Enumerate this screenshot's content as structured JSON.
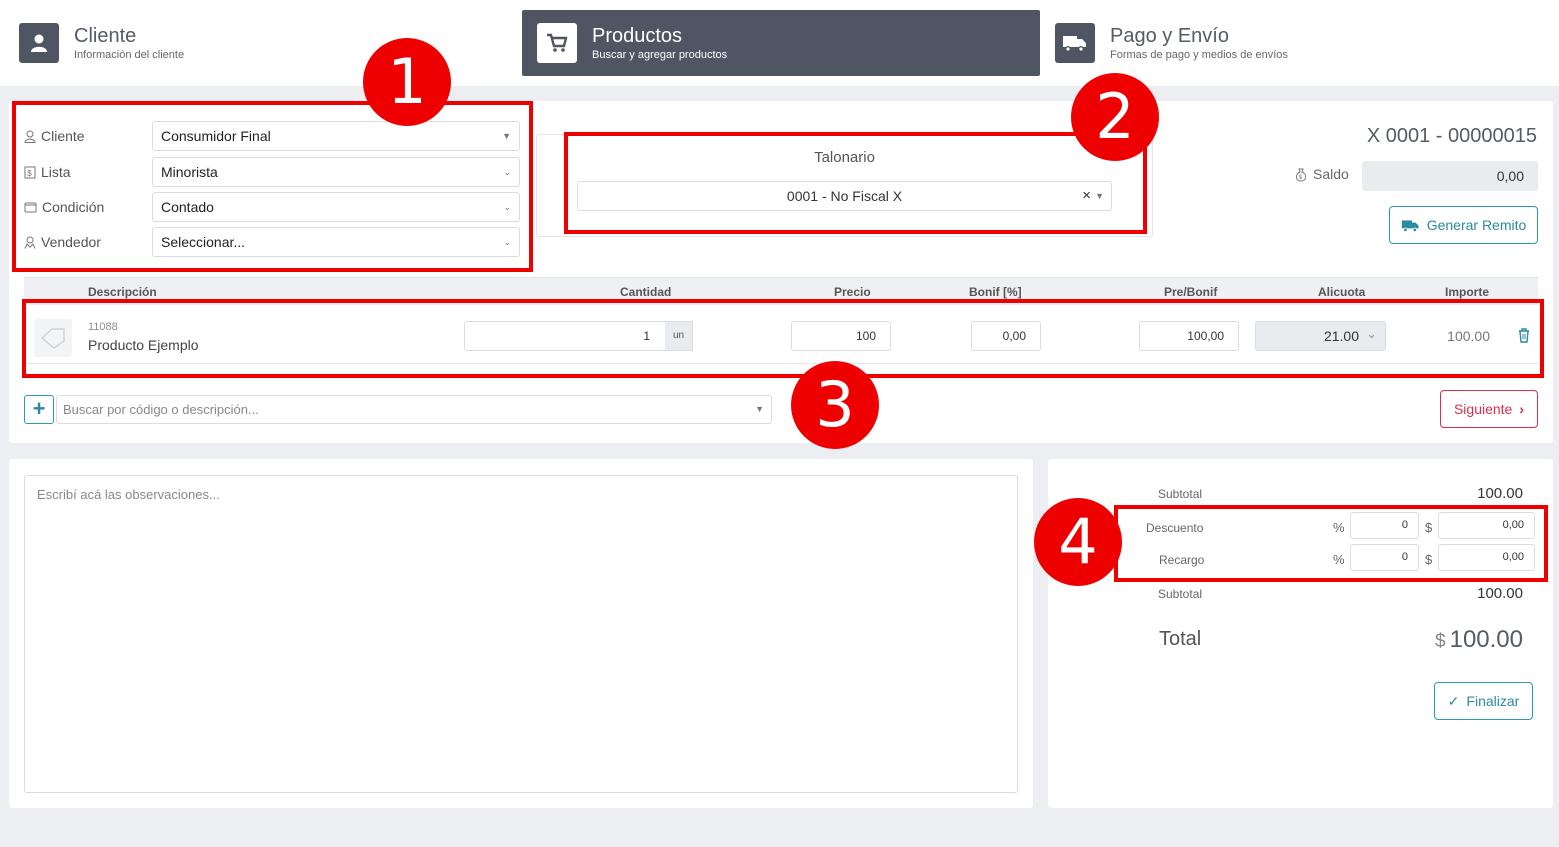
{
  "stepper": {
    "steps": [
      {
        "title": "Cliente",
        "subtitle": "Información del cliente",
        "icon": "user-icon"
      },
      {
        "title": "Productos",
        "subtitle": "Buscar y agregar productos",
        "icon": "cart-icon"
      },
      {
        "title": "Pago y Envío",
        "subtitle": "Formas de pago y medios de envíos",
        "icon": "truck-icon"
      }
    ]
  },
  "client_form": {
    "rows": [
      {
        "label": "Cliente",
        "value": "Consumidor Final",
        "icon": "user-icon"
      },
      {
        "label": "Lista",
        "value": "Minorista",
        "icon": "price-list-icon"
      },
      {
        "label": "Condición",
        "value": "Contado",
        "icon": "wallet-icon"
      },
      {
        "label": "Vendedor",
        "value": "Seleccionar...",
        "icon": "seller-icon"
      }
    ]
  },
  "talonario": {
    "title": "Talonario",
    "value": "0001 - No Fiscal X",
    "clear": "×"
  },
  "document": {
    "number": "X 0001 - 00000015",
    "saldo_label": "Saldo",
    "saldo_value": "0,00",
    "remito_button": "Generar Remito"
  },
  "table": {
    "headers": {
      "descripcion": "Descripción",
      "cantidad": "Cantidad",
      "precio": "Precio",
      "bonif": "Bonif [%]",
      "prebonif": "Pre/Bonif",
      "alicuota": "Alicuota",
      "importe": "Importe"
    },
    "rows": [
      {
        "code": "11088",
        "name": "Producto Ejemplo",
        "cantidad": "1",
        "unit": "un",
        "precio": "100",
        "bonif": "0,00",
        "prebonif": "100,00",
        "alicuota": "21.00",
        "importe": "100.00"
      }
    ]
  },
  "search": {
    "placeholder": "Buscar por código o descripción...",
    "add": "+",
    "next_button": "Siguiente"
  },
  "observations": {
    "placeholder": "Escribí acá las observaciones..."
  },
  "totals": {
    "subtotal_label": "Subtotal",
    "subtotal_value": "100.00",
    "descuento_label": "Descuento",
    "descuento_pct": "0",
    "descuento_amount": "0,00",
    "recargo_label": "Recargo",
    "recargo_pct": "0",
    "recargo_amount": "0,00",
    "subtotal2_label": "Subtotal",
    "subtotal2_value": "100.00",
    "pct_symbol": "%",
    "currency_symbol": "$",
    "total_label": "Total",
    "total_currency": "$",
    "total_value": "100.00",
    "finalize_button": "Finalizar"
  },
  "annotations": [
    "1",
    "2",
    "3",
    "4"
  ],
  "colors": {
    "accent": "#2a9cb1",
    "header_active": "#4f5563",
    "annotation": "#ee0000",
    "next_button": "#d9304f"
  }
}
